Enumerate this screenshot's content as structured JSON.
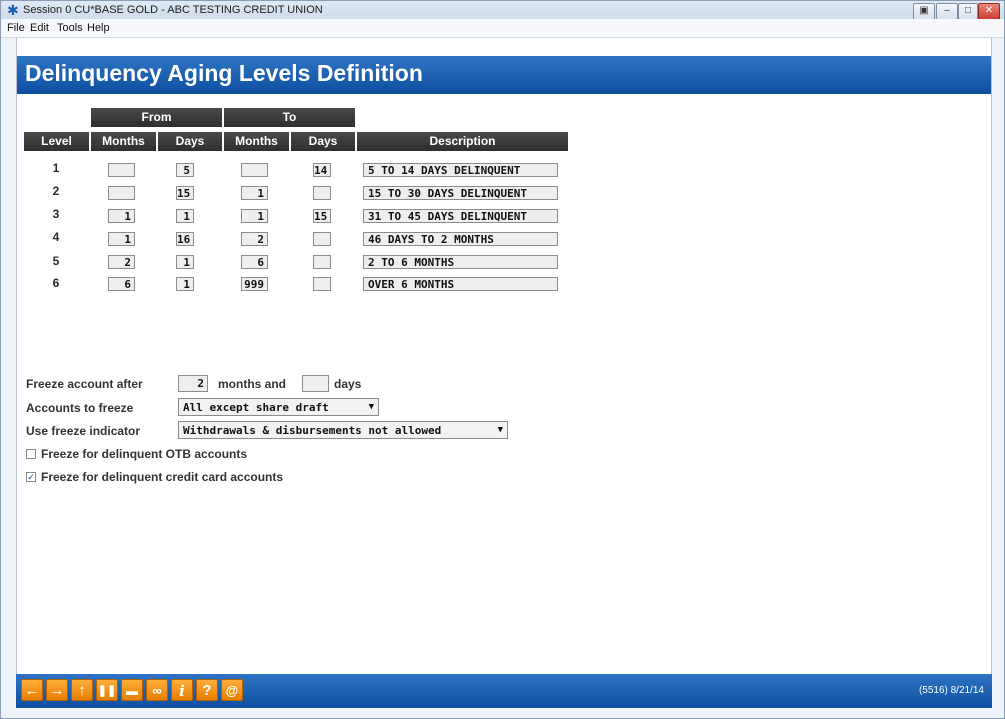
{
  "window": {
    "title": "Session 0 CU*BASE GOLD - ABC TESTING CREDIT UNION",
    "menu": [
      "File",
      "Edit",
      "Tools",
      "Help"
    ]
  },
  "page": {
    "title": "Delinquency Aging Levels Definition"
  },
  "table": {
    "group_from": "From",
    "group_to": "To",
    "headers": [
      "Level",
      "Months",
      "Days",
      "Months",
      "Days",
      "Description"
    ],
    "rows": [
      {
        "level": "1",
        "from_months": "",
        "from_days": "5",
        "to_months": "",
        "to_days": "14",
        "description": "5 TO 14 DAYS DELINQUENT"
      },
      {
        "level": "2",
        "from_months": "",
        "from_days": "15",
        "to_months": "1",
        "to_days": "",
        "description": "15 TO 30 DAYS DELINQUENT"
      },
      {
        "level": "3",
        "from_months": "1",
        "from_days": "1",
        "to_months": "1",
        "to_days": "15",
        "description": "31 TO 45 DAYS DELINQUENT"
      },
      {
        "level": "4",
        "from_months": "1",
        "from_days": "16",
        "to_months": "2",
        "to_days": "",
        "description": "46 DAYS TO 2 MONTHS"
      },
      {
        "level": "5",
        "from_months": "2",
        "from_days": "1",
        "to_months": "6",
        "to_days": "",
        "description": "2 TO 6 MONTHS"
      },
      {
        "level": "6",
        "from_months": "6",
        "from_days": "1",
        "to_months": "999",
        "to_days": "",
        "description": "OVER 6 MONTHS"
      }
    ]
  },
  "freeze": {
    "after_label": "Freeze account after",
    "months_value": "2",
    "months_and_label": "months and",
    "days_value": "",
    "days_label": "days",
    "accounts_label": "Accounts to freeze",
    "accounts_value": "All except share draft",
    "indicator_label": "Use freeze indicator",
    "indicator_value": "Withdrawals & disbursements not allowed",
    "otb_label": "Freeze for delinquent OTB accounts",
    "otb_checked": false,
    "cc_label": "Freeze for delinquent credit card accounts",
    "cc_checked": true
  },
  "footer": {
    "version": "(5516) 8/21/14"
  },
  "colors": {
    "banner": "#1a5fb4",
    "footer_button": "#f39200",
    "header_cell": "#3a3a3a"
  }
}
